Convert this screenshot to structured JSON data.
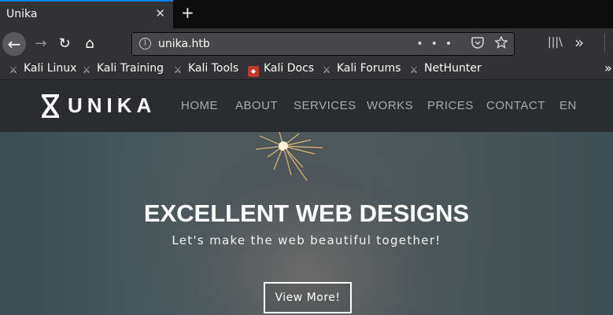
{
  "browser": {
    "tab": {
      "title": "Unika",
      "close": "✕"
    },
    "new_tab": "+",
    "nav": {
      "back": "←",
      "forward": "→",
      "reload": "↻",
      "home": "⌂"
    },
    "url": "unika.htb",
    "url_actions": "•••",
    "bookmarks": [
      {
        "label": "Kali Linux",
        "icon": "kali-dragon-icon"
      },
      {
        "label": "Kali Training",
        "icon": "kali-dragon-icon"
      },
      {
        "label": "Kali Tools",
        "icon": "kali-dragon-icon"
      },
      {
        "label": "Kali Docs",
        "icon": "kali-docs-icon"
      },
      {
        "label": "Kali Forums",
        "icon": "kali-dragon-icon"
      },
      {
        "label": "NetHunter",
        "icon": "nethunter-icon"
      }
    ],
    "bookmarks_more": "»",
    "accent_color": "#0a84ff"
  },
  "site": {
    "logo": "UNIKA",
    "menu": [
      "HOME",
      "ABOUT",
      "SERVICES",
      "WORKS",
      "PRICES",
      "CONTACT",
      "EN"
    ],
    "hero": {
      "title": "EXCELLENT WEB DESIGNS",
      "subtitle": "Let's make the web beautiful together!",
      "button": "View More!"
    }
  }
}
